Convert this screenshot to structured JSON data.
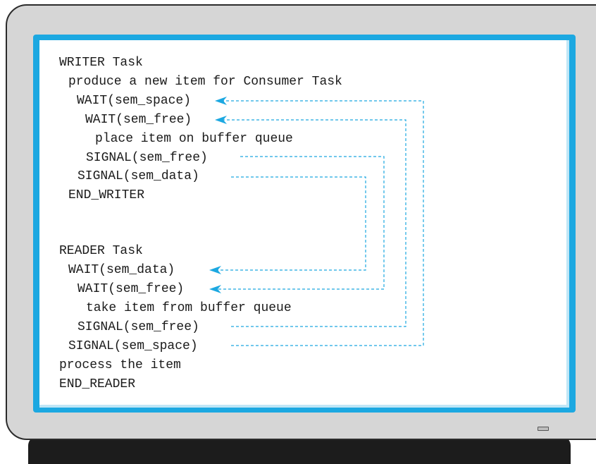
{
  "code_lines": [
    "WRITER Task",
    "produce a new item for Consumer Task",
    "WAIT(sem_space)",
    "WAIT(sem_free)",
    "place item on buffer queue",
    "SIGNAL(sem_free)",
    "SIGNAL(sem_data)",
    "END_WRITER",
    "READER Task",
    "WAIT(sem_data)",
    "WAIT(sem_free)",
    "take item from buffer queue",
    "SIGNAL(sem_free)",
    "SIGNAL(sem_space)",
    "process the item",
    "END_READER"
  ],
  "arrow_color": "#1ca8e1",
  "frame_color": "#1ca8e1"
}
